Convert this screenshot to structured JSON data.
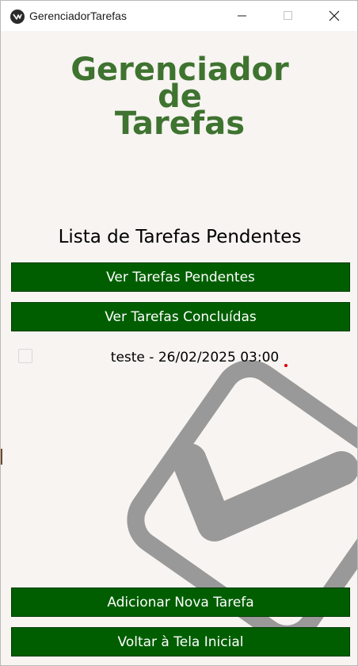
{
  "window": {
    "title": "GerenciadorTarefas"
  },
  "heading": {
    "line1": "Gerenciador",
    "line2": "de",
    "line3": "Tarefas"
  },
  "list_title": "Lista de Tarefas Pendentes",
  "buttons": {
    "view_pending": "Ver Tarefas Pendentes",
    "view_done": "Ver Tarefas Concluídas",
    "add_task": "Adicionar Nova Tarefa",
    "back_home": "Voltar à Tela Inicial"
  },
  "tasks": [
    {
      "label": "teste - 26/02/2025 03:00",
      "checked": false
    }
  ],
  "colors": {
    "heading": "#3f7330",
    "button_bg": "#005e00",
    "button_text": "#ffffff",
    "background": "#f7f4f1",
    "watermark": "#999999"
  },
  "icons": {
    "app": "app-logo-icon",
    "minimize": "minimize-icon",
    "maximize": "maximize-icon",
    "close": "close-icon",
    "watermark": "checkbox-check-icon"
  }
}
